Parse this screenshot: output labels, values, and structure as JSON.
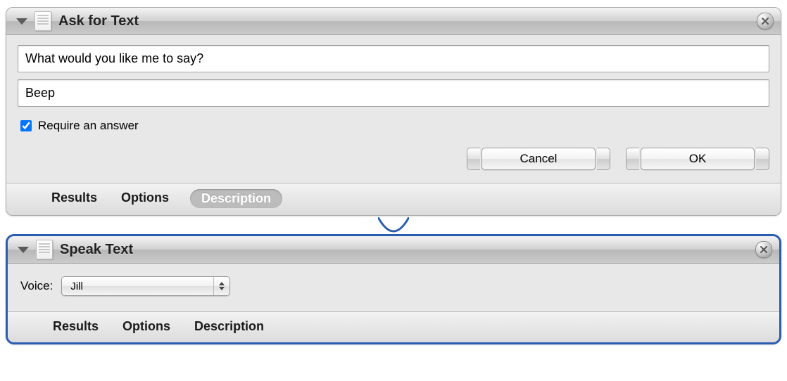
{
  "panels": {
    "ask": {
      "title": "Ask for Text",
      "prompt_value": "What would you like me to say?",
      "default_value": "Beep",
      "require_label": "Require an answer",
      "require_checked": true,
      "buttons": {
        "cancel": "Cancel",
        "ok": "OK"
      },
      "tabs": {
        "results": "Results",
        "options": "Options",
        "description": "Description"
      },
      "active_tab": "description"
    },
    "speak": {
      "title": "Speak Text",
      "voice_label": "Voice:",
      "voice_value": "Jill",
      "tabs": {
        "results": "Results",
        "options": "Options",
        "description": "Description"
      }
    }
  }
}
